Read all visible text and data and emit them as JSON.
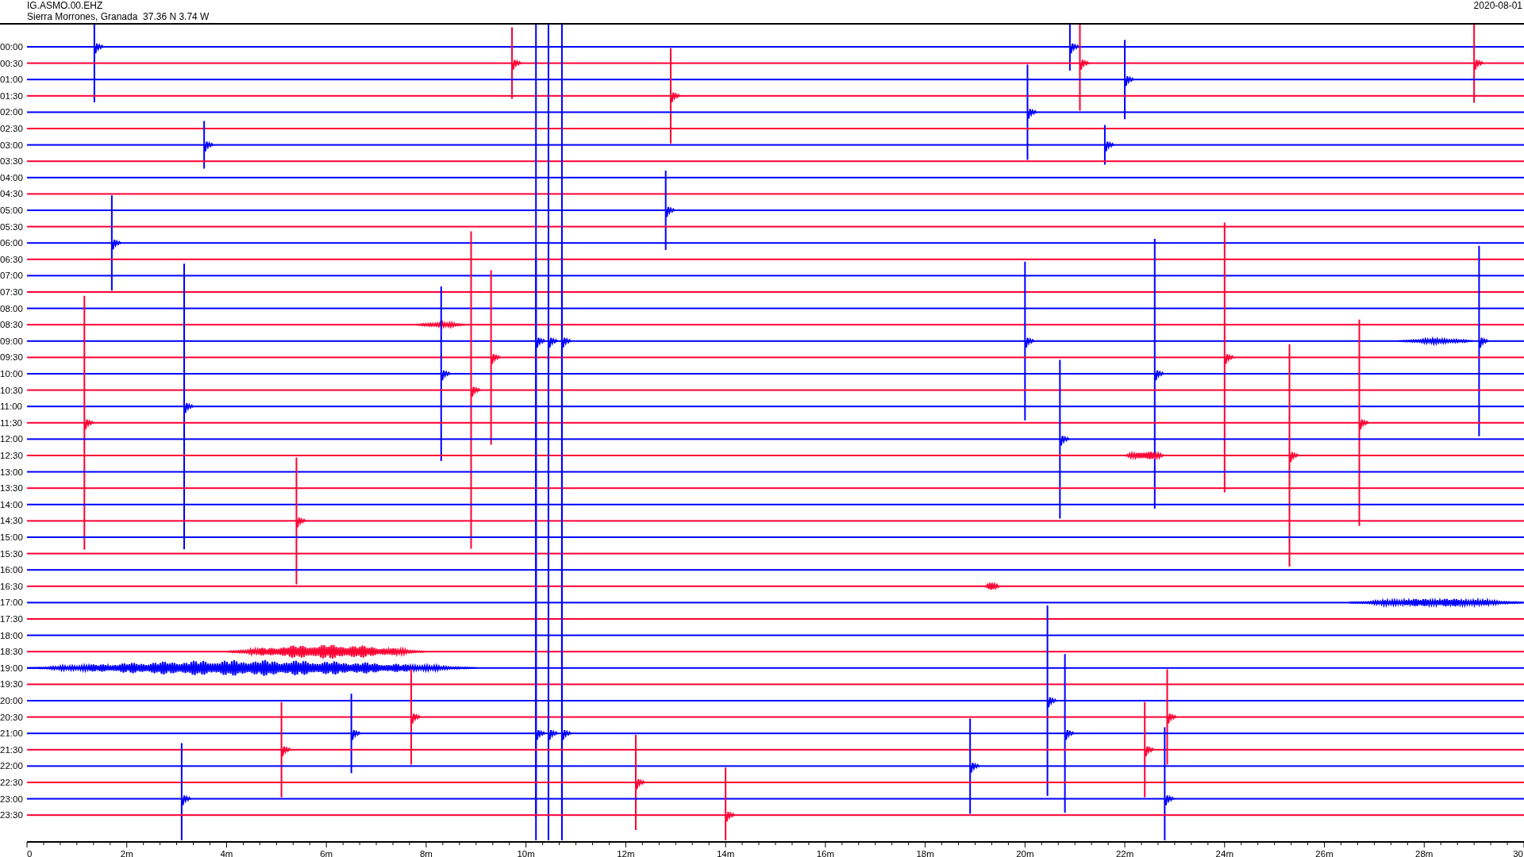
{
  "header": {
    "station": "IG.ASMO.00.EHZ",
    "location": "Sierra Morrones, Granada  37.36 N 3.74 W",
    "date": "2020-08-01"
  },
  "rows": [
    {
      "label": "00:00",
      "color": "#0000ff"
    },
    {
      "label": "00:30",
      "color": "#ff0033"
    },
    {
      "label": "01:00",
      "color": "#0000ff"
    },
    {
      "label": "01:30",
      "color": "#ff0033"
    },
    {
      "label": "02:00",
      "color": "#0000ff"
    },
    {
      "label": "02:30",
      "color": "#ff0033"
    },
    {
      "label": "03:00",
      "color": "#0000ff"
    },
    {
      "label": "03:30",
      "color": "#ff0033"
    },
    {
      "label": "04:00",
      "color": "#0000ff"
    },
    {
      "label": "04:30",
      "color": "#ff0033"
    },
    {
      "label": "05:00",
      "color": "#0000ff"
    },
    {
      "label": "05:30",
      "color": "#ff0033"
    },
    {
      "label": "06:00",
      "color": "#0000ff"
    },
    {
      "label": "06:30",
      "color": "#ff0033"
    },
    {
      "label": "07:00",
      "color": "#0000ff"
    },
    {
      "label": "07:30",
      "color": "#ff0033"
    },
    {
      "label": "08:00",
      "color": "#0000ff"
    },
    {
      "label": "08:30",
      "color": "#ff0033"
    },
    {
      "label": "09:00",
      "color": "#0000ff"
    },
    {
      "label": "09:30",
      "color": "#ff0033"
    },
    {
      "label": "10:00",
      "color": "#0000ff"
    },
    {
      "label": "10:30",
      "color": "#ff0033"
    },
    {
      "label": "11:00",
      "color": "#0000ff"
    },
    {
      "label": "11:30",
      "color": "#ff0033"
    },
    {
      "label": "12:00",
      "color": "#0000ff"
    },
    {
      "label": "12:30",
      "color": "#ff0033"
    },
    {
      "label": "13:00",
      "color": "#0000ff"
    },
    {
      "label": "13:30",
      "color": "#ff0033"
    },
    {
      "label": "14:00",
      "color": "#0000ff"
    },
    {
      "label": "14:30",
      "color": "#ff0033"
    },
    {
      "label": "15:00",
      "color": "#0000ff"
    },
    {
      "label": "15:30",
      "color": "#ff0033"
    },
    {
      "label": "16:00",
      "color": "#0000ff"
    },
    {
      "label": "16:30",
      "color": "#ff0033"
    },
    {
      "label": "17:00",
      "color": "#0000ff"
    },
    {
      "label": "17:30",
      "color": "#ff0033"
    },
    {
      "label": "18:00",
      "color": "#0000ff"
    },
    {
      "label": "18:30",
      "color": "#ff0033"
    },
    {
      "label": "19:00",
      "color": "#0000ff"
    },
    {
      "label": "19:30",
      "color": "#ff0033"
    },
    {
      "label": "20:00",
      "color": "#0000ff"
    },
    {
      "label": "20:30",
      "color": "#ff0033"
    },
    {
      "label": "21:00",
      "color": "#0000ff"
    },
    {
      "label": "21:30",
      "color": "#ff0033"
    },
    {
      "label": "22:00",
      "color": "#0000ff"
    },
    {
      "label": "22:30",
      "color": "#ff0033"
    },
    {
      "label": "23:00",
      "color": "#0000ff"
    },
    {
      "label": "23:30",
      "color": "#ff0033"
    }
  ],
  "x_axis": {
    "tick_labels": [
      "0",
      "2m",
      "4m",
      "6m",
      "8m",
      "10m",
      "12m",
      "14m",
      "16m",
      "18m",
      "20m",
      "22m",
      "24m",
      "26m",
      "28m",
      "30"
    ]
  }
}
